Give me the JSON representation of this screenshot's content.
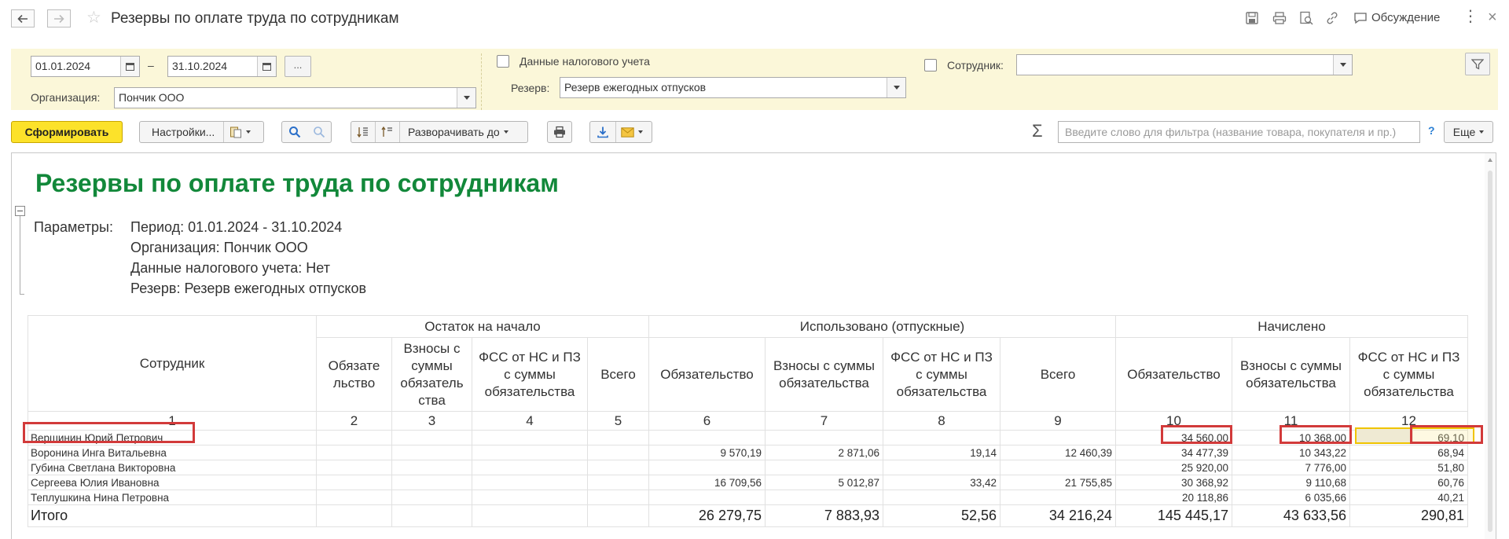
{
  "window": {
    "title": "Резервы по оплате труда по сотрудникам",
    "discussion_label": "Обсуждение"
  },
  "filters": {
    "date_from": "01.01.2024",
    "date_to": "31.10.2024",
    "period_separator": "–",
    "period_more_label": "...",
    "org_label": "Организация:",
    "org_value": "Пончик ООО",
    "tax_data_label": "Данные налогового учета",
    "tax_data_checked": false,
    "reserve_label": "Резерв:",
    "reserve_value": "Резерв ежегодных отпусков",
    "employee_label": "Сотрудник:",
    "employee_checked": false,
    "employee_value": ""
  },
  "toolbar": {
    "generate_label": "Сформировать",
    "settings_label": "Настройки...",
    "expand_label": "Разворачивать до",
    "search_placeholder": "Введите слово для фильтра (название товара, покупателя и пр.)",
    "help_label": "?",
    "more_label": "Еще"
  },
  "report": {
    "title": "Резервы по оплате труда по сотрудникам",
    "params_label": "Параметры:",
    "params": [
      "Период: 01.01.2024 - 31.10.2024",
      "Организация: Пончик ООО",
      "Данные налогового учета: Нет",
      "Резерв: Резерв ежегодных отпусков"
    ],
    "employee_header": "Сотрудник",
    "groups": [
      "Остаток на начало",
      "Использовано (отпускные)",
      "Начислено"
    ],
    "subheaders": [
      "Обязате льство",
      "Взносы с суммы обязатель ства",
      "ФСС от НС и ПЗ с суммы обязательства",
      "Всего",
      "Обязательство",
      "Взносы с суммы обязательства",
      "ФСС от НС и ПЗ с суммы обязательства",
      "Всего",
      "Обязательство",
      "Взносы с суммы обязательства",
      "ФСС от НС и ПЗ с суммы обязательства"
    ],
    "col_numbers": [
      "1",
      "2",
      "3",
      "4",
      "5",
      "6",
      "7",
      "8",
      "9",
      "10",
      "11",
      "12"
    ],
    "rows": [
      {
        "name": "Вершинин Юрий Петрович",
        "vals": [
          "",
          "",
          "",
          "",
          "",
          "",
          "",
          "",
          "34 560,00",
          "10 368,00",
          "69,10"
        ]
      },
      {
        "name": "Воронина Инга Витальевна",
        "vals": [
          "",
          "",
          "",
          "",
          "9 570,19",
          "2 871,06",
          "19,14",
          "12 460,39",
          "34 477,39",
          "10 343,22",
          "68,94"
        ]
      },
      {
        "name": "Губина Светлана Викторовна",
        "vals": [
          "",
          "",
          "",
          "",
          "",
          "",
          "",
          "",
          "25 920,00",
          "7 776,00",
          "51,80"
        ]
      },
      {
        "name": "Сергеева Юлия Ивановна",
        "vals": [
          "",
          "",
          "",
          "",
          "16 709,56",
          "5 012,87",
          "33,42",
          "21 755,85",
          "30 368,92",
          "9 110,68",
          "60,76"
        ]
      },
      {
        "name": "Теплушкина Нина Петровна",
        "vals": [
          "",
          "",
          "",
          "",
          "",
          "",
          "",
          "",
          "20 118,86",
          "6 035,66",
          "40,21"
        ]
      }
    ],
    "total": {
      "name": "Итого",
      "vals": [
        "",
        "",
        "",
        "",
        "26 279,75",
        "7 883,93",
        "52,56",
        "34 216,24",
        "145 445,17",
        "43 633,56",
        "290,81"
      ]
    }
  },
  "colors": {
    "accent_green": "#12883a",
    "primary_button": "#fce22a",
    "filter_panel": "#fbf7d9",
    "highlight_red": "#d23a3a"
  }
}
